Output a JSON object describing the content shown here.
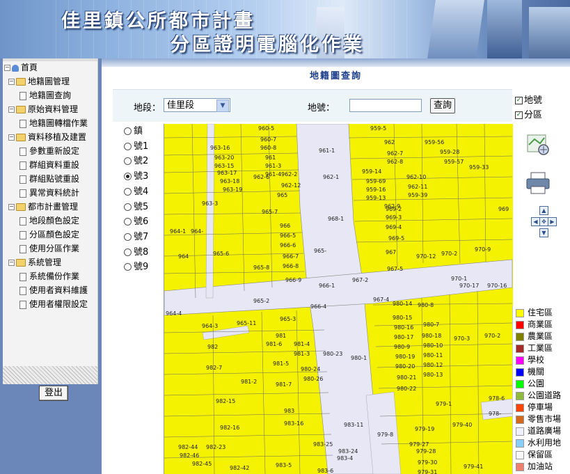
{
  "banner": {
    "line1": "佳里鎮公所都市計畫",
    "line2": "分區證明電腦化作業"
  },
  "tree": [
    {
      "label": "首頁",
      "type": "home",
      "level": 0
    },
    {
      "label": "地籍圖管理",
      "type": "folder",
      "level": 1
    },
    {
      "label": "地籍圖查詢",
      "type": "doc",
      "level": 2
    },
    {
      "label": "原始資料管理",
      "type": "folder",
      "level": 1
    },
    {
      "label": "地籍圖轉檔作業",
      "type": "doc",
      "level": 2
    },
    {
      "label": "資料移植及建置",
      "type": "folder",
      "level": 1
    },
    {
      "label": "參數重新設定",
      "type": "doc",
      "level": 2
    },
    {
      "label": "群組資料重設",
      "type": "doc",
      "level": 2
    },
    {
      "label": "群組點號重設",
      "type": "doc",
      "level": 2
    },
    {
      "label": "異常資料統計",
      "type": "doc",
      "level": 2
    },
    {
      "label": "都市計畫管理",
      "type": "folder",
      "level": 1
    },
    {
      "label": "地段顏色設定",
      "type": "doc",
      "level": 2
    },
    {
      "label": "分區顏色設定",
      "type": "doc",
      "level": 2
    },
    {
      "label": "使用分區作業",
      "type": "doc",
      "level": 2
    },
    {
      "label": "系統管理",
      "type": "folder",
      "level": 1
    },
    {
      "label": "系統備份作業",
      "type": "doc",
      "level": 2
    },
    {
      "label": "使用者資料維護",
      "type": "doc",
      "level": 2
    },
    {
      "label": "使用者權限設定",
      "type": "doc",
      "level": 2
    }
  ],
  "logout_label": "登出",
  "page_title": "地籍圖查詢",
  "search": {
    "section_label": "地段：",
    "section_value": "佳里段",
    "number_label": "地號：",
    "number_value": "",
    "query_button": "查詢"
  },
  "checks": [
    {
      "label": "地號",
      "checked": true
    },
    {
      "label": "分區",
      "checked": true
    }
  ],
  "radios": [
    {
      "label": "鎮",
      "checked": false
    },
    {
      "label": "號1",
      "checked": false
    },
    {
      "label": "號2",
      "checked": false
    },
    {
      "label": "號3",
      "checked": true
    },
    {
      "label": "號4",
      "checked": false
    },
    {
      "label": "號5",
      "checked": false
    },
    {
      "label": "號6",
      "checked": false
    },
    {
      "label": "號7",
      "checked": false
    },
    {
      "label": "號8",
      "checked": false
    },
    {
      "label": "號9",
      "checked": false
    }
  ],
  "map_labels": [
    "960-5",
    "960-7",
    "960-8",
    "961",
    "961-1",
    "963-16",
    "963-20",
    "963-15",
    "961-3",
    "961-4",
    "962-6",
    "962-2",
    "962-1",
    "963-17",
    "963-18",
    "963-19",
    "962-12",
    "965",
    "963-3",
    "965-7",
    "959-5",
    "962",
    "962-7",
    "962-8",
    "959-14",
    "959-69",
    "959-16",
    "959-13",
    "962-9",
    "962-10",
    "962-11",
    "959-39",
    "959-56",
    "959-28",
    "959-57",
    "959-33",
    "969",
    "969-2",
    "969-3",
    "969-4",
    "969-5",
    "968-1",
    "966",
    "966-5",
    "966-6",
    "966-7",
    "966-8",
    "966-9",
    "965-6",
    "965-",
    "965-8",
    "964-1",
    "964-",
    "964",
    "967",
    "970-12",
    "970-2",
    "970-9",
    "967-5",
    "967-2",
    "970-1",
    "970-17",
    "970-16",
    "966-1",
    "966-4",
    "965-2",
    "964-4",
    "967-4",
    "980-14",
    "980-8",
    "980-15",
    "980-16",
    "980-7",
    "980-17",
    "980-18",
    "980-9",
    "980-10",
    "980-19",
    "980-11",
    "980-20",
    "980-12",
    "980-21",
    "980-13",
    "980-22",
    "965-3",
    "965-11",
    "964-3",
    "981",
    "981-4",
    "981-6",
    "981-3",
    "981-5",
    "981-2",
    "981-7",
    "980-23",
    "980-24",
    "980-26",
    "980-1",
    "970-3",
    "970-2",
    "982",
    "982-7",
    "982-15",
    "983",
    "983-16",
    "983-11",
    "983-25",
    "979-1",
    "979-8",
    "979-19",
    "979-40",
    "979-27",
    "979-28",
    "979-30",
    "979-31",
    "979-41",
    "978-6",
    "982-23",
    "982-46",
    "982-44",
    "982-45",
    "982-42",
    "983-5",
    "983-6",
    "983-4",
    "983-24",
    "982-16",
    "978-"
  ],
  "legend": [
    {
      "label": "住宅區",
      "color": "#ffff00"
    },
    {
      "label": "商業區",
      "color": "#ff0000"
    },
    {
      "label": "農業區",
      "color": "#808000"
    },
    {
      "label": "工業區",
      "color": "#a52a2a"
    },
    {
      "label": "學校",
      "color": "#ff00ff"
    },
    {
      "label": "機關",
      "color": "#0000ff"
    },
    {
      "label": "公園",
      "color": "#00ff00"
    },
    {
      "label": "公園道路",
      "color": "#8fbc3f"
    },
    {
      "label": "停車場",
      "color": "#ff4500"
    },
    {
      "label": "零售市場",
      "color": "#d2691e"
    },
    {
      "label": "道路廣場",
      "color": "#f0f0ff"
    },
    {
      "label": "水利用地",
      "color": "#87cefa"
    },
    {
      "label": "保留區",
      "color": "#f8f8f8"
    },
    {
      "label": "加油站",
      "color": "#f08070"
    }
  ],
  "icons": [
    "map-zoom-icon",
    "printer-icon",
    "pan-up-icon",
    "pan-left-icon",
    "pan-center-icon",
    "pan-right-icon",
    "pan-down-icon"
  ]
}
